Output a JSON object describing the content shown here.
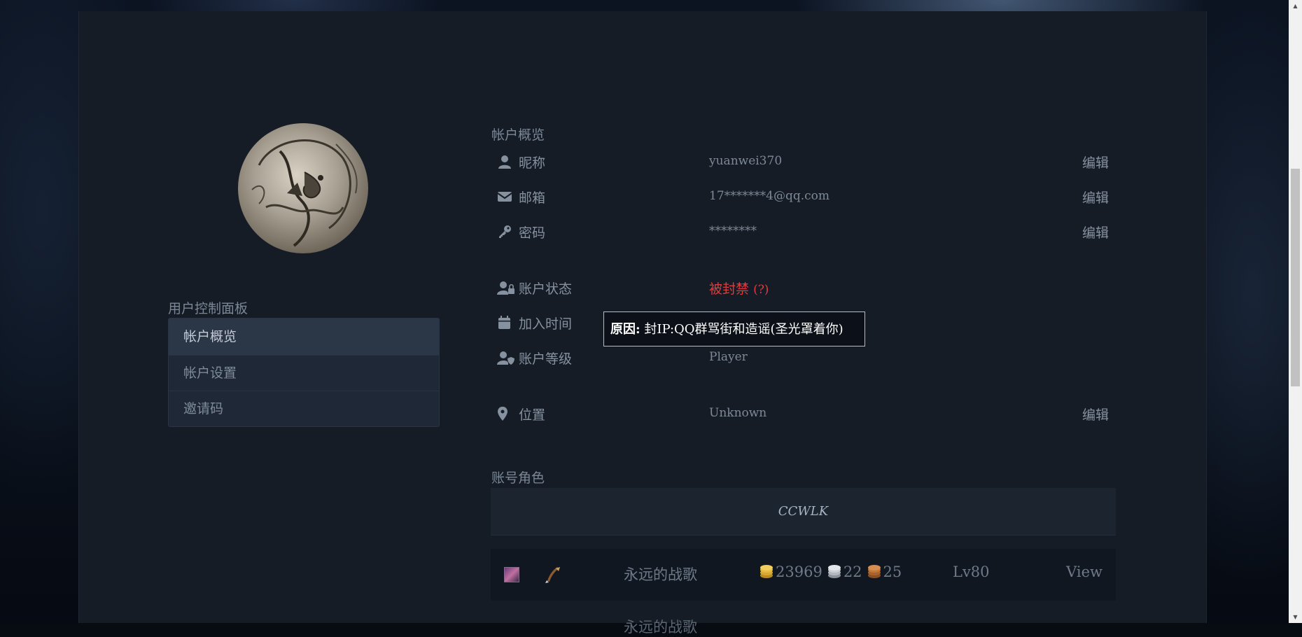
{
  "overview": {
    "title": "帐户概览",
    "rows": [
      {
        "label": "昵称",
        "value": "yuanwei370",
        "edit": "编辑"
      },
      {
        "label": "邮箱",
        "value": "17*******4@qq.com",
        "edit": "编辑"
      },
      {
        "label": "密码",
        "value": "********",
        "edit": "编辑"
      },
      {
        "label": "账户状态",
        "value": "被封禁",
        "hint": "(?)"
      },
      {
        "label": "加入时间",
        "value": ""
      },
      {
        "label": "账户等级",
        "value": "Player"
      },
      {
        "label": "位置",
        "value": "Unknown",
        "edit": "编辑"
      }
    ],
    "status_color": "#e23b3b"
  },
  "tooltip": {
    "prefix": "原因:",
    "text": "封IP:QQ群骂街和造谣(圣光罩着你)"
  },
  "sidebar": {
    "title": "用户控制面板",
    "items": [
      {
        "label": "帐户概览",
        "active": true
      },
      {
        "label": "帐户设置",
        "active": false
      },
      {
        "label": "邀请码",
        "active": false
      }
    ]
  },
  "characters": {
    "title": "账号角色",
    "realm": "CCWLK",
    "list": [
      {
        "name": "永远的战歌",
        "gold": "23969",
        "silver": "22",
        "copper": "25",
        "level": "Lv80",
        "action": "View",
        "race_icon": "female-orc-portrait-icon",
        "class_icon": "rogue-class-icon"
      },
      {
        "name": "永远的战歌",
        "partial": true
      }
    ]
  },
  "icons": {
    "nickname": "user-icon",
    "email": "envelope-icon",
    "password": "key-icon",
    "status": "user-lock-icon",
    "joined": "calendar-icon",
    "rank": "user-shield-icon",
    "location": "map-marker-icon"
  }
}
